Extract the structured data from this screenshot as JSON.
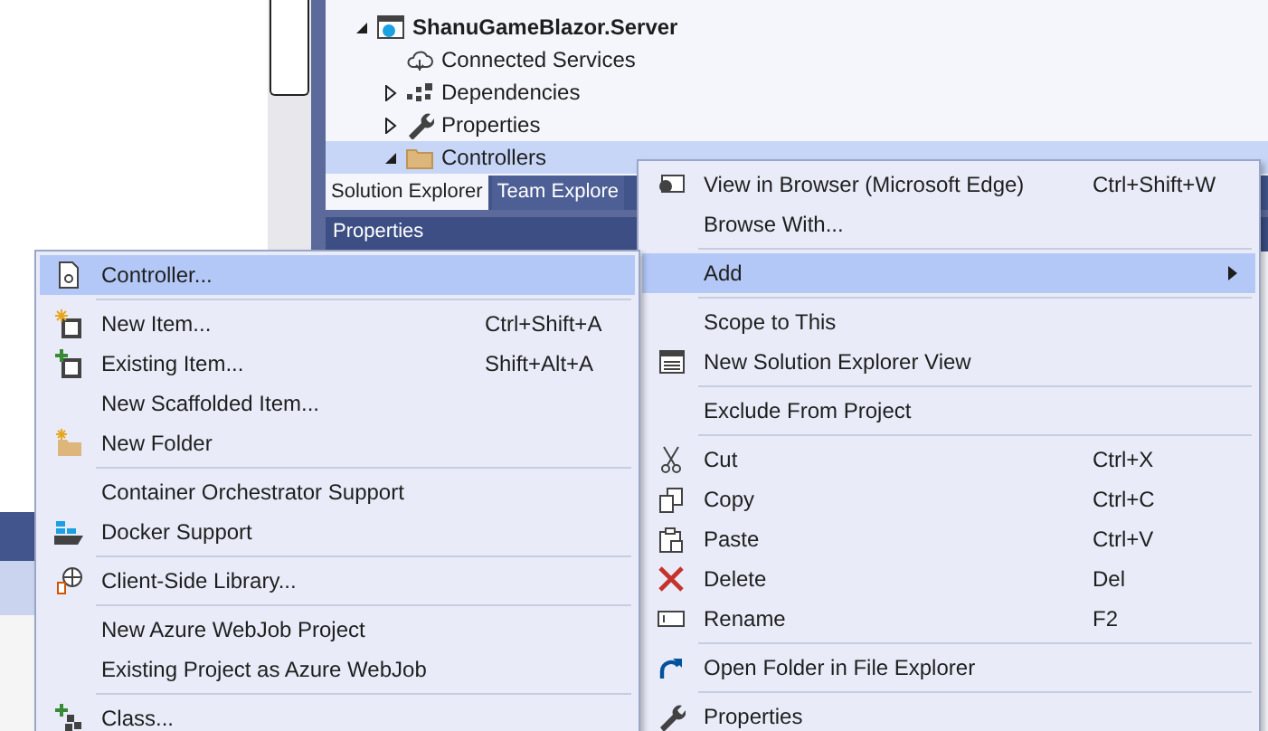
{
  "solution_explorer": {
    "tree": [
      {
        "label": "ShanuGameBlazor.Server",
        "expanded": true,
        "selected": false,
        "children": [
          {
            "label": "Connected Services",
            "selected": false
          },
          {
            "label": "Dependencies",
            "expanded": false,
            "selected": false
          },
          {
            "label": "Properties",
            "expanded": false,
            "selected": false
          },
          {
            "label": "Controllers",
            "expanded": true,
            "selected": true
          }
        ]
      }
    ],
    "tabs": [
      {
        "label": "Solution Explorer",
        "selected": true
      },
      {
        "label": "Team Explore",
        "selected": false
      }
    ]
  },
  "properties_panel": {
    "title": "Properties"
  },
  "context_menu": {
    "groups": [
      [
        {
          "label": "View in Browser (Microsoft Edge)",
          "shortcut": "Ctrl+Shift+W",
          "selected": false
        },
        {
          "label": "Browse With...",
          "selected": false
        }
      ],
      [
        {
          "label": "Add",
          "selected": true,
          "has_submenu": true
        }
      ],
      [
        {
          "label": "Scope to This",
          "selected": false
        },
        {
          "label": "New Solution Explorer View",
          "selected": false
        }
      ],
      [
        {
          "label": "Exclude From Project",
          "selected": false
        }
      ],
      [
        {
          "label": "Cut",
          "shortcut": "Ctrl+X",
          "selected": false
        },
        {
          "label": "Copy",
          "shortcut": "Ctrl+C",
          "selected": false
        },
        {
          "label": "Paste",
          "shortcut": "Ctrl+V",
          "selected": false
        },
        {
          "label": "Delete",
          "shortcut": "Del",
          "selected": false
        },
        {
          "label": "Rename",
          "shortcut": "F2",
          "selected": false
        }
      ],
      [
        {
          "label": "Open Folder in File Explorer",
          "selected": false
        }
      ],
      [
        {
          "label": "Properties",
          "selected": false
        }
      ]
    ]
  },
  "add_submenu": {
    "groups": [
      [
        {
          "label": "Controller...",
          "selected": true
        }
      ],
      [
        {
          "label": "New Item...",
          "shortcut": "Ctrl+Shift+A",
          "selected": false
        },
        {
          "label": "Existing Item...",
          "shortcut": "Shift+Alt+A",
          "selected": false
        },
        {
          "label": "New Scaffolded Item...",
          "selected": false
        },
        {
          "label": "New Folder",
          "selected": false
        }
      ],
      [
        {
          "label": "Container Orchestrator Support",
          "selected": false
        },
        {
          "label": "Docker Support",
          "selected": false
        }
      ],
      [
        {
          "label": "Client-Side Library...",
          "selected": false
        }
      ],
      [
        {
          "label": "New Azure WebJob Project",
          "selected": false
        },
        {
          "label": "Existing Project as Azure WebJob",
          "selected": false
        }
      ],
      [
        {
          "label": "Class...",
          "selected": false
        }
      ]
    ]
  }
}
